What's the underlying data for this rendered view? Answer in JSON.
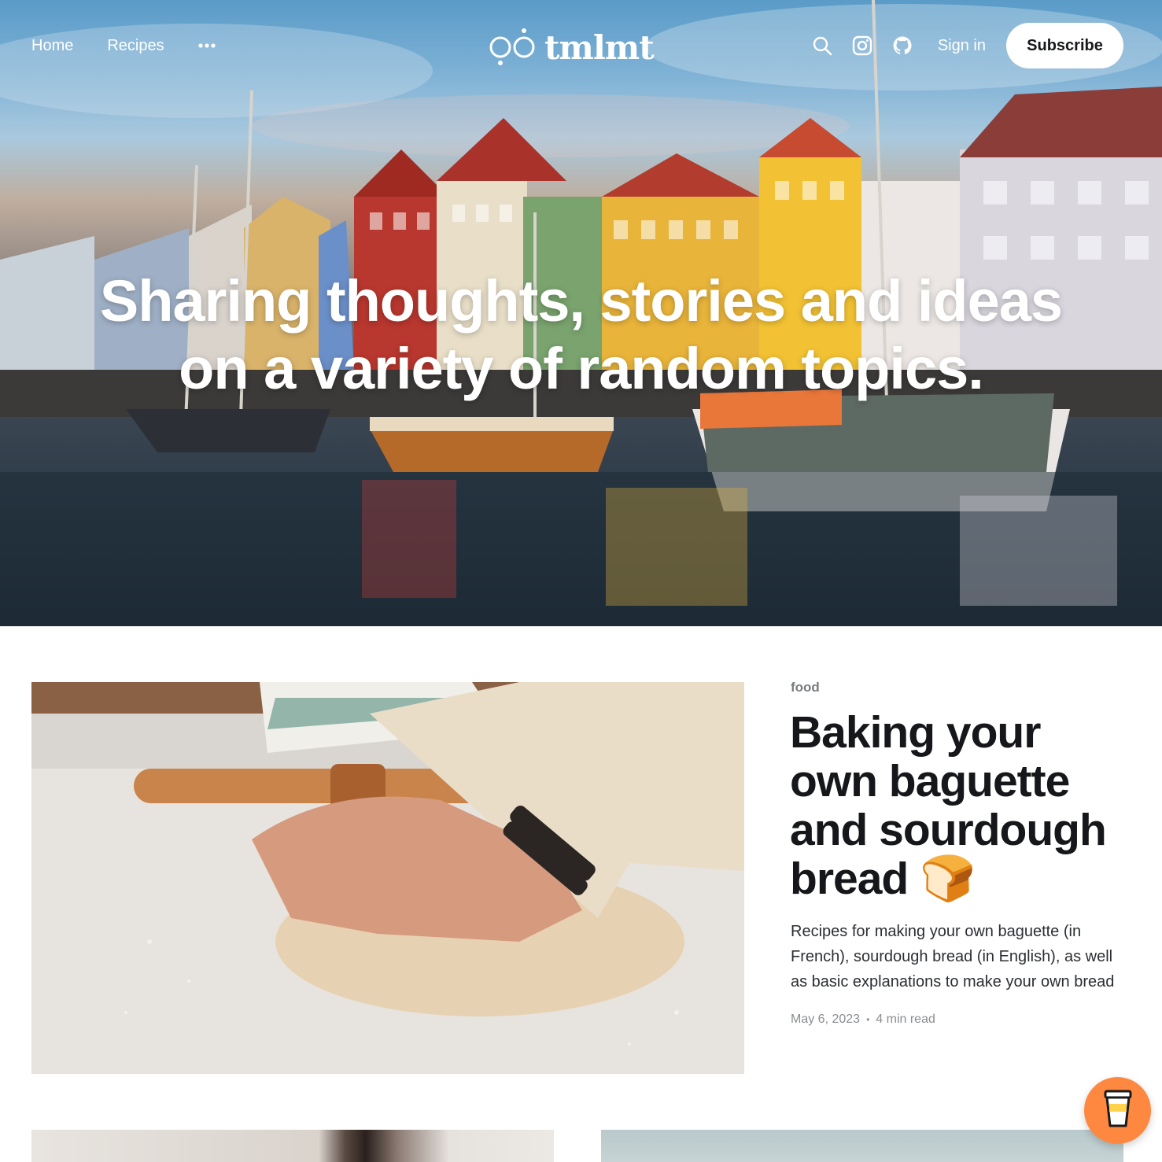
{
  "nav": {
    "home": "Home",
    "recipes": "Recipes",
    "more_icon": "ellipsis-icon",
    "sign_in": "Sign in",
    "subscribe": "Subscribe"
  },
  "brand": {
    "name": "tmlmt",
    "logo_icon": "tmlmt-logo-icon"
  },
  "hero": {
    "headline_line1": "Sharing thoughts, stories and ideas",
    "headline_line2": "on a variety of random topics.",
    "image_description_icon": "harbor-photo"
  },
  "featured_post": {
    "tag": "food",
    "title": "Baking your own baguette and sourdough bread 🍞",
    "excerpt": "Recipes for making your own baguette (in French), sourdough bread (in English), as well as basic explanations to make your own bread at home.",
    "date": "May 6, 2023",
    "read_time": "4 min read"
  },
  "icons": [
    "search-icon",
    "instagram-icon",
    "github-icon",
    "coffee-cup-icon"
  ],
  "colors": {
    "accent": "#ff8840",
    "text": "#15171a",
    "muted": "#7a7d80"
  }
}
